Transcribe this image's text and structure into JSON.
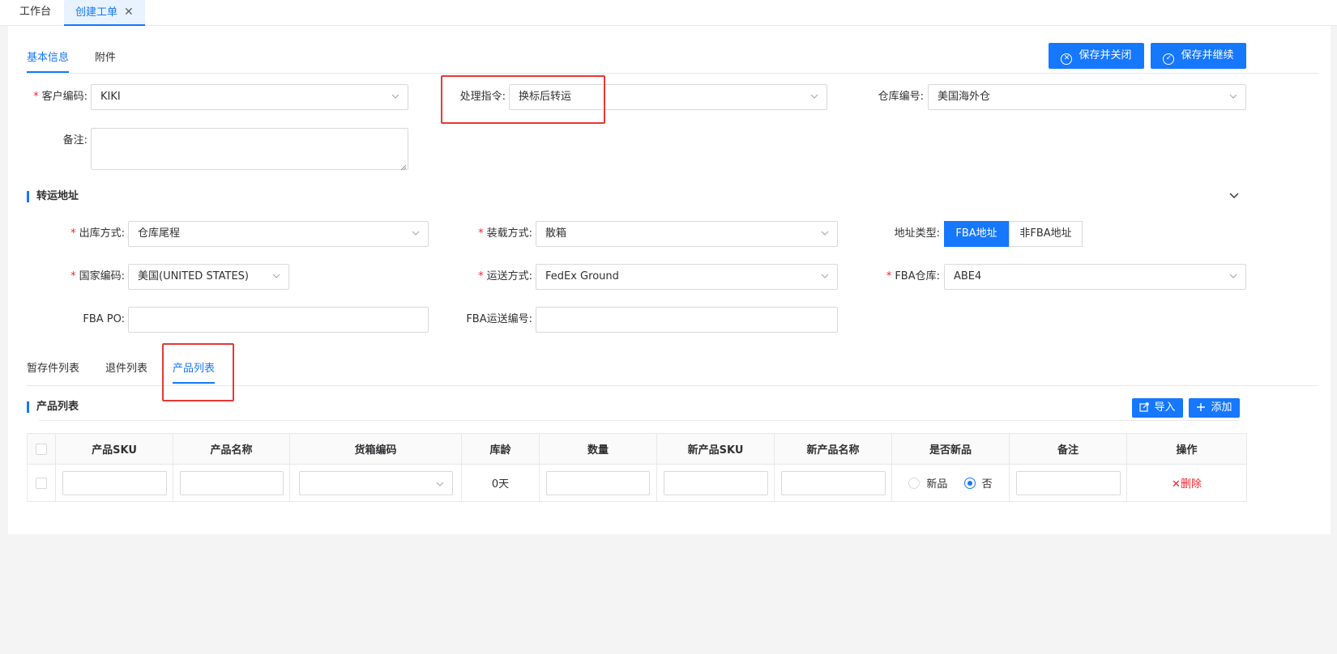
{
  "tabs": [
    {
      "label": "工作台"
    },
    {
      "label": "创建工单"
    }
  ],
  "tab_close_glyph": "✕",
  "form_tabs": [
    {
      "label": "基本信息"
    },
    {
      "label": "附件"
    }
  ],
  "buttons": {
    "save_close": "保存并关闭",
    "save_continue": "保存并继续"
  },
  "basic": {
    "customer_code_label": "客户编码:",
    "customer_code_value": "KIKI",
    "instruction_label": "处理指令:",
    "instruction_value": "换标后转运",
    "warehouse_label": "仓库编号:",
    "warehouse_value": "美国海外仓",
    "remark_label": "备注:"
  },
  "transfer": {
    "title": "转运地址",
    "outbound_label": "出库方式:",
    "outbound_value": "仓库尾程",
    "loading_label": "装载方式:",
    "loading_value": "散箱",
    "address_type_label": "地址类型:",
    "address_type_options": [
      "FBA地址",
      "非FBA地址"
    ],
    "address_type_selected": "FBA地址",
    "country_label": "国家编码:",
    "country_value": "美国(UNITED STATES)",
    "shipping_label": "运送方式:",
    "shipping_value": "FedEx Ground",
    "fba_wh_label": "FBA仓库:",
    "fba_wh_value": "ABE4",
    "fba_po_label": "FBA PO:",
    "fba_ship_no_label": "FBA运送编号:"
  },
  "list_tabs": [
    {
      "label": "暂存件列表"
    },
    {
      "label": "退件列表"
    },
    {
      "label": "产品列表"
    }
  ],
  "product_list": {
    "title": "产品列表",
    "import_label": "导入",
    "add_label": "添加",
    "columns": [
      "产品SKU",
      "产品名称",
      "货箱编码",
      "库龄",
      "数量",
      "新产品SKU",
      "新产品名称",
      "是否新品",
      "备注",
      "操作"
    ],
    "rows": [
      {
        "age": "0天",
        "radio_new": "新品",
        "radio_no": "否",
        "selected": "否",
        "delete": "删除"
      }
    ]
  },
  "delete_glyph": "✕",
  "colors": {
    "accent": "#1677ff",
    "danger": "#f5222d",
    "highlight_box": "#e53935"
  }
}
